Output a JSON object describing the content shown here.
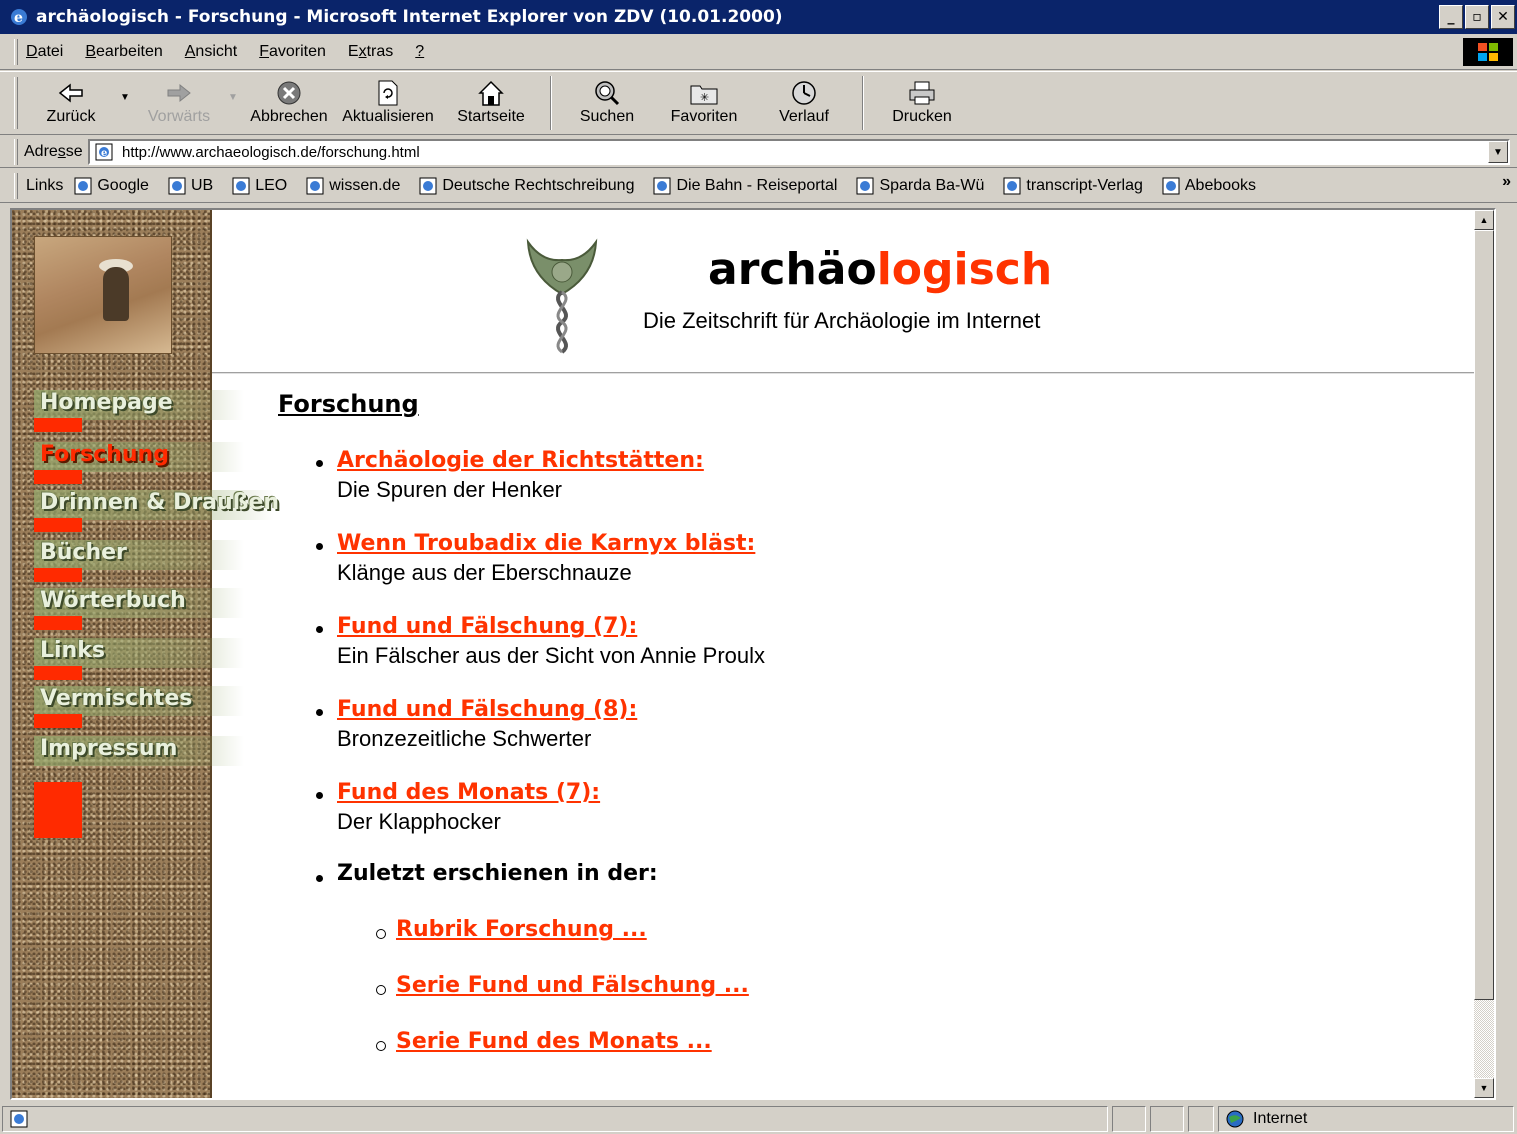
{
  "window": {
    "title": "archäologisch - Forschung - Microsoft Internet Explorer von ZDV (10.01.2000)"
  },
  "menu": [
    {
      "label": "Datei",
      "ul": "D",
      "rest": "atei"
    },
    {
      "label": "Bearbeiten",
      "ul": "B",
      "rest": "earbeiten"
    },
    {
      "label": "Ansicht",
      "ul": "A",
      "rest": "nsicht"
    },
    {
      "label": "Favoriten",
      "ul": "F",
      "rest": "avoriten"
    },
    {
      "label": "Extras",
      "pre": "E",
      "ul": "x",
      "rest": "tras"
    },
    {
      "label": "?",
      "ul": "?",
      "rest": ""
    }
  ],
  "toolbar": {
    "back": "Zurück",
    "forward": "Vorwärts",
    "stop": "Abbrechen",
    "refresh": "Aktualisieren",
    "home": "Startseite",
    "search": "Suchen",
    "favorites": "Favoriten",
    "history": "Verlauf",
    "print": "Drucken"
  },
  "address": {
    "label_pre": "Adre",
    "label_ul": "s",
    "label_post": "se",
    "url": "http://www.archaeologisch.de/forschung.html"
  },
  "links": {
    "label": "Links",
    "items": [
      "Google",
      "UB",
      "LEO",
      "wissen.de",
      "Deutsche Rechtschreibung",
      "Die Bahn - Reiseportal",
      "Sparda Ba-Wü",
      "transcript-Verlag",
      "Abebooks"
    ]
  },
  "site": {
    "logo_black": "archäo",
    "logo_red": "logisch",
    "tagline": "Die Zeitschrift für Archäologie im Internet"
  },
  "nav": [
    {
      "label": "Homepage",
      "active": false
    },
    {
      "label": "Forschung",
      "active": true
    },
    {
      "label": "Drinnen & Draußen",
      "active": false
    },
    {
      "label": "Bücher",
      "active": false
    },
    {
      "label": "Wörterbuch",
      "active": false
    },
    {
      "label": "Links",
      "active": false
    },
    {
      "label": "Vermischtes",
      "active": false
    },
    {
      "label": "Impressum",
      "active": false
    }
  ],
  "page": {
    "heading": "Forschung",
    "articles": [
      {
        "title": "Archäologie der Richtstätten:",
        "subtitle": "Die Spuren der Henker"
      },
      {
        "title": "Wenn Troubadix die Karnyx bläst:",
        "subtitle": "Klänge aus der Eberschnauze"
      },
      {
        "title": "Fund und Fälschung (7):",
        "subtitle": "Ein Fälscher aus der Sicht von Annie Proulx"
      },
      {
        "title": "Fund und Fälschung (8):",
        "subtitle": "Bronzezeitliche Schwerter"
      },
      {
        "title": "Fund des Monats (7):",
        "subtitle": "Der Klapphocker"
      }
    ],
    "recent_label": "Zuletzt erschienen in der:",
    "recent_links": [
      "Rubrik Forschung ...",
      "Serie Fund und Fälschung ...",
      "Serie Fund des Monats ..."
    ]
  },
  "status": {
    "zone": "Internet"
  },
  "colors": {
    "titlebar": "#0a246a",
    "chrome": "#d4d0c8",
    "accent_red": "#ff3300"
  }
}
